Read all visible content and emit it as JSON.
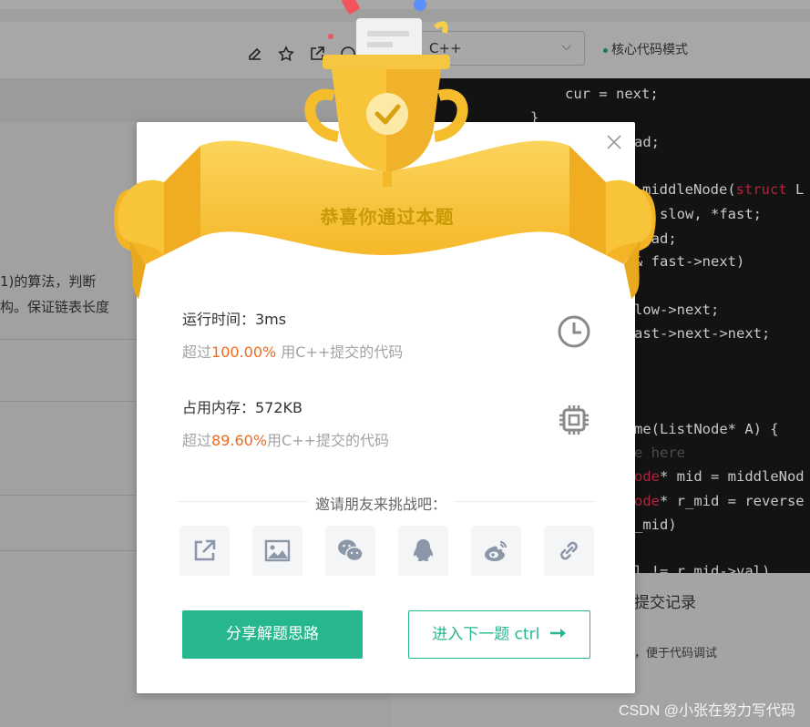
{
  "toolbar": {
    "language": "C++",
    "mode_label": "核心代码模式"
  },
  "background": {
    "problem_text_1": "1)的算法，判断",
    "problem_text_2": "构。保证链表长度",
    "code_lines": [
      {
        "indent": "      ",
        "code": "cur = next;"
      },
      {
        "indent": "    ",
        "code": "}"
      },
      {
        "indent": "",
        "code": "ad;"
      },
      {
        "indent": "",
        "code": "middleNode(struct L"
      },
      {
        "indent": "",
        "code": "e* slow, *fast;"
      },
      {
        "indent": "",
        "code": "head;"
      },
      {
        "indent": "",
        "code": "& fast->next)"
      },
      {
        "indent": "",
        "code": "low->next;"
      },
      {
        "indent": "",
        "code": "ast->next->next;"
      },
      {
        "indent": "",
        "code": "me(ListNode* A) {"
      },
      {
        "indent": "",
        "code": "e here"
      },
      {
        "indent": "",
        "code": "ode* mid = middleNod"
      },
      {
        "indent": "",
        "code": "ode* r_mid = reverse"
      },
      {
        "indent": "",
        "code": "_mid)"
      },
      {
        "indent": "",
        "code": "l != r_mid->val)"
      }
    ],
    "submit_title": "提交记录",
    "submit_sub": "，便于代码调试",
    "watermark": "CSDN @小张在努力写代码"
  },
  "modal": {
    "banner_title": "恭喜你通过本题",
    "runtime_label": "运行时间：3ms",
    "runtime_prefix": "超过",
    "runtime_percent": "100.00%",
    "runtime_suffix": " 用C++提交的代码",
    "memory_label": "占用内存：572KB",
    "memory_prefix": "超过",
    "memory_percent": "89.60%",
    "memory_suffix": "用C++提交的代码",
    "invite_text": "邀请朋友来挑战吧：",
    "share_icons": [
      "external-link-icon",
      "image-icon",
      "wechat-icon",
      "qq-icon",
      "weibo-icon",
      "link-icon"
    ],
    "primary_button": "分享解题思路",
    "next_button": "进入下一题 ctrl",
    "colors": {
      "accent": "#27b78f",
      "highlight": "#f06a1c",
      "banner": "#f8c53a"
    }
  }
}
